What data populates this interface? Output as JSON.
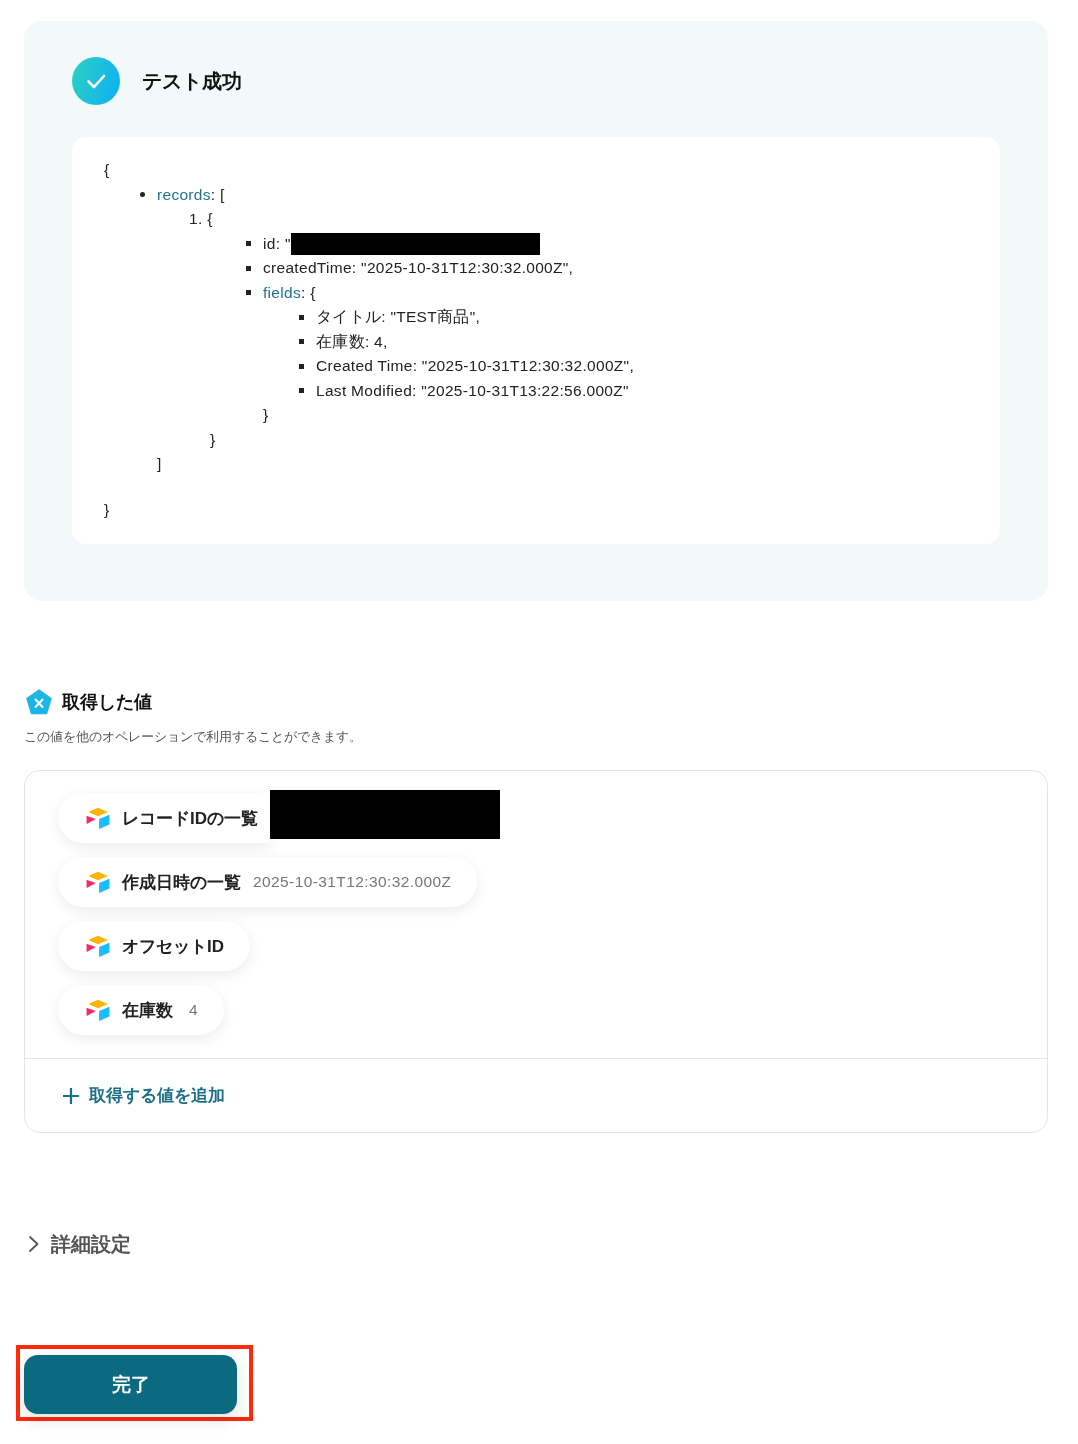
{
  "test_result": {
    "title": "テスト成功",
    "output": {
      "open": "{",
      "entries": [
        {
          "key": "records",
          "text": ": [",
          "children": [
            {
              "marker": "1.",
              "text": "{",
              "children": [
                {
                  "text": "id: \"",
                  "redacted": true
                },
                {
                  "text": "createdTime: \"2025-10-31T12:30:32.000Z\",",
                  "redacted": false
                },
                {
                  "key": "fields",
                  "text": ": {",
                  "children": [
                    {
                      "text": "タイトル: \"TEST商品\",",
                      "redacted": false
                    },
                    {
                      "text": "在庫数: 4,",
                      "redacted": false
                    },
                    {
                      "text": "Created Time: \"2025-10-31T12:30:32.000Z\",",
                      "redacted": false
                    },
                    {
                      "text": "Last Modified: \"2025-10-31T13:22:56.000Z\"",
                      "redacted": false
                    }
                  ],
                  "close": "}"
                }
              ],
              "close": "}"
            }
          ],
          "close": "]"
        }
      ],
      "close": "}"
    }
  },
  "fetched_values": {
    "title": "取得した値",
    "description": "この値を他のオペレーションで利用することができます。",
    "items": [
      {
        "label": "レコードIDの一覧",
        "redacted": true
      },
      {
        "label": "作成日時の一覧",
        "value": "2025-10-31T12:30:32.000Z",
        "redacted": false
      },
      {
        "label": "オフセットID",
        "redacted": false
      },
      {
        "label": "在庫数",
        "value": "4",
        "redacted": false
      }
    ],
    "add_button": "取得する値を追加"
  },
  "advanced_settings": {
    "label": "詳細設定",
    "expanded": false
  },
  "done_button": {
    "label": "完了",
    "highlighted": true
  }
}
